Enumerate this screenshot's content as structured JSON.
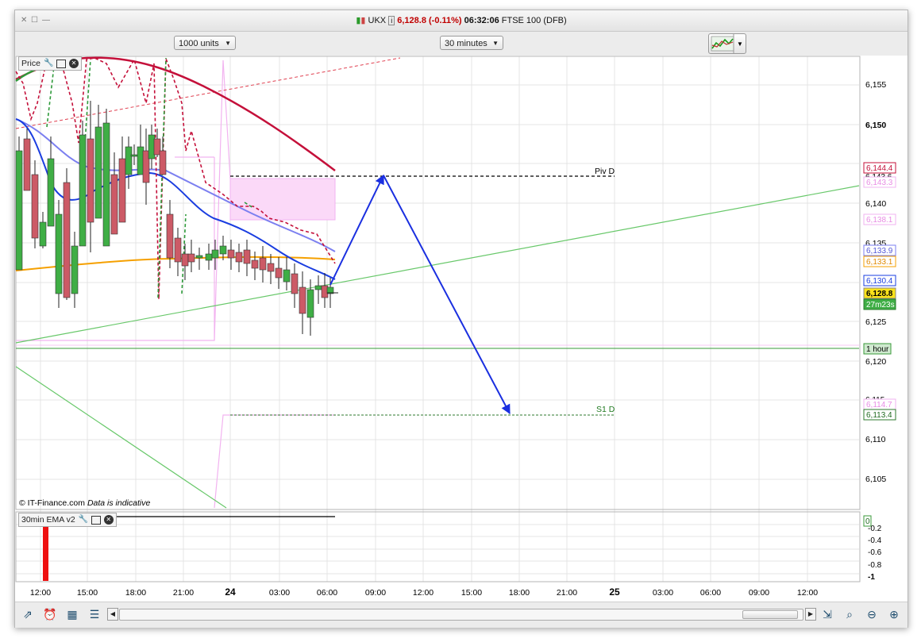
{
  "window": {
    "symbol": "UKX",
    "price": "6,128.8",
    "change": "(-0.11%)",
    "time": "06:32:06",
    "instrument": "FTSE 100 (DFB)"
  },
  "toolbar": {
    "units": "1000 units",
    "interval": "30 minutes"
  },
  "price_panel": {
    "label": "Price",
    "copyright": "© IT-Finance.com",
    "disclaimer": "Data is indicative",
    "piv_label": "Piv D",
    "s1_label": "S1 D",
    "yaxis_ticks": [
      "6,155",
      "6,150",
      "6,143.6",
      "6,140",
      "6,135",
      "6,125",
      "6,120",
      "6,115",
      "6,110",
      "6,105"
    ],
    "tags": {
      "t1": "6,144.4",
      "t2": "6,143.3",
      "t3": "6,138.1",
      "t4": "6,133.9",
      "t5": "6,133.1",
      "t6": "6,130.4",
      "t7": "6,128.8",
      "t8": "27m23s",
      "t9": "1 hour",
      "t10": "6,114.7",
      "t11": "6,113.4"
    }
  },
  "indicator_panel": {
    "label": "30min EMA v2",
    "yaxis_ticks": [
      "0",
      "-0.2",
      "-0.4",
      "-0.6",
      "-0.8",
      "-1"
    ]
  },
  "xaxis": [
    "12:00",
    "15:00",
    "18:00",
    "21:00",
    "24",
    "03:00",
    "06:00",
    "09:00",
    "12:00",
    "15:00",
    "18:00",
    "21:00",
    "25",
    "03:00",
    "06:00",
    "09:00",
    "12:00"
  ],
  "colors": {
    "bull": "#3fae45",
    "bear": "#cc5a66",
    "ema_blue": "#1a3de0",
    "ema_light": "#7b7ff0",
    "ema_orange": "#f5a000",
    "ema_red": "#c4103a",
    "pivot_pink": "#f2b3f0",
    "trend_green": "#68c86a",
    "arrow": "#1a2fe0"
  }
}
